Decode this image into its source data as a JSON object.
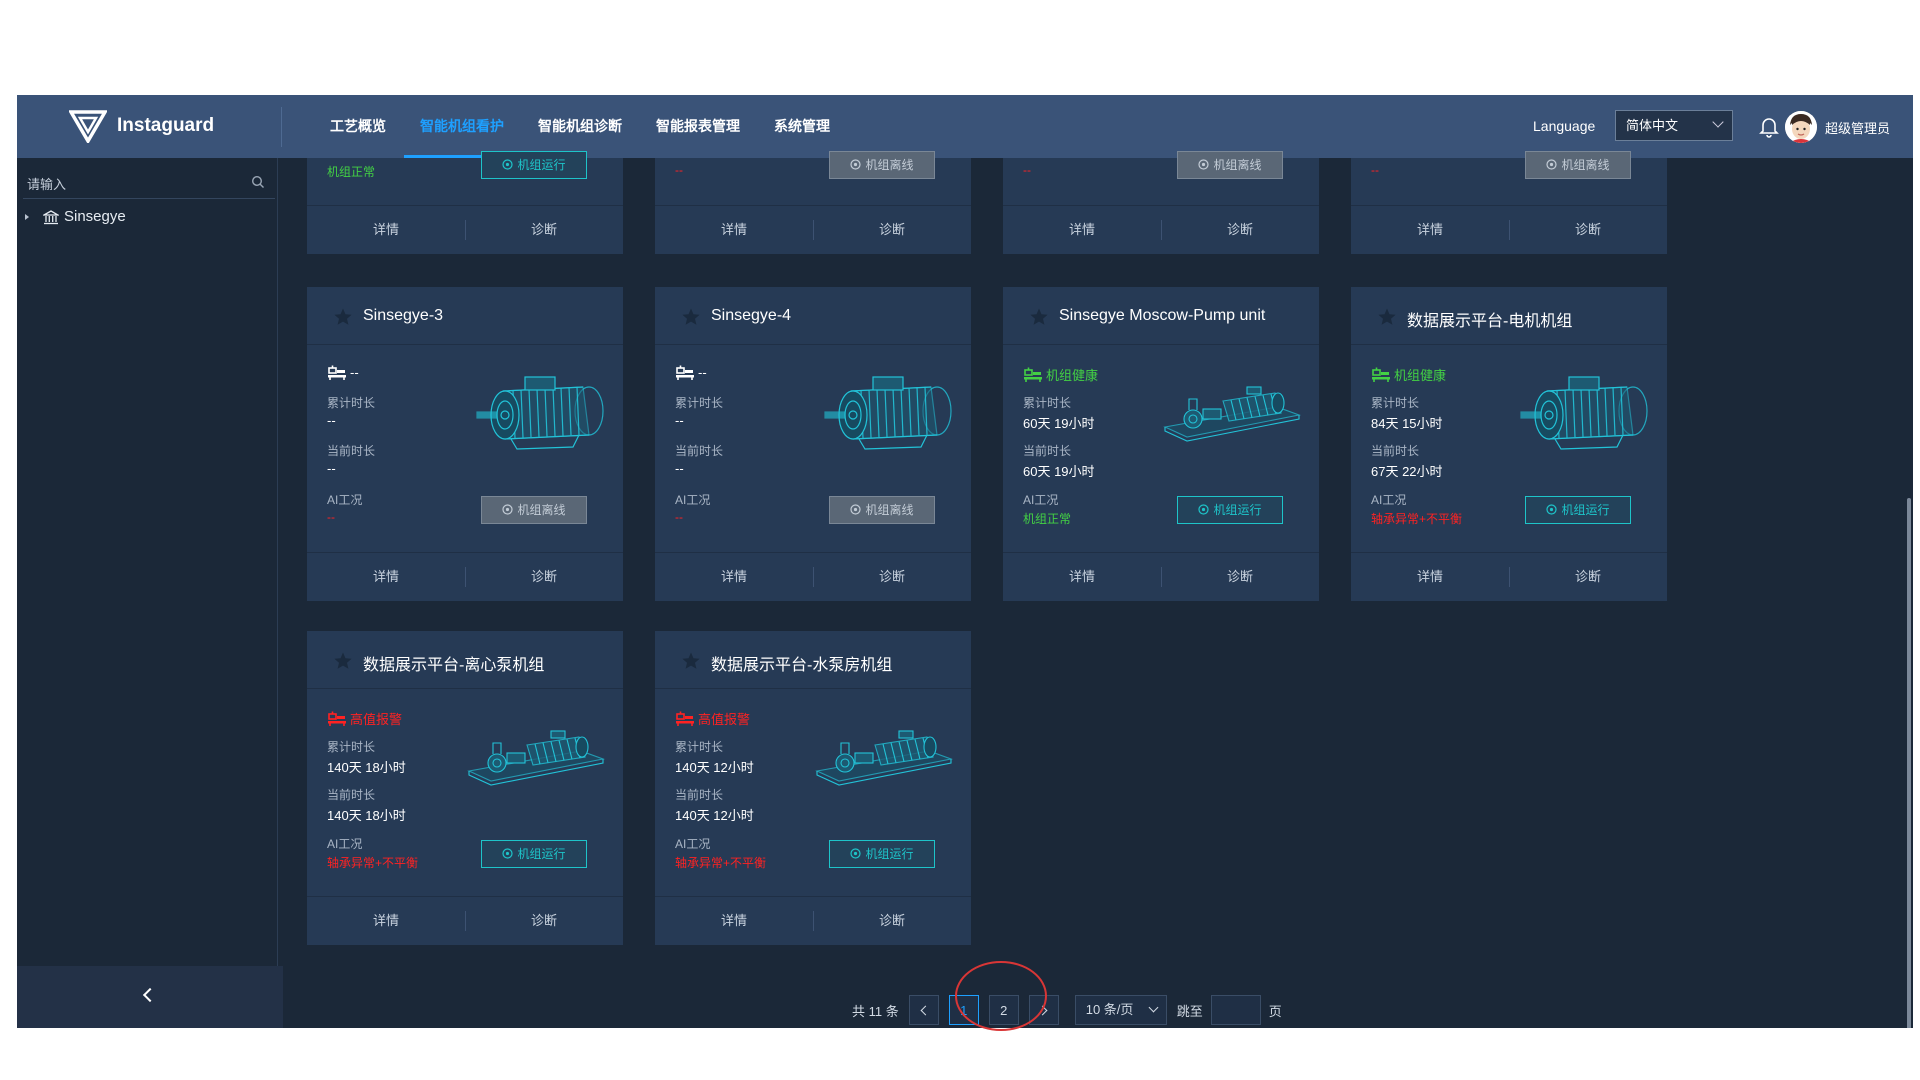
{
  "header": {
    "brand": "Instaguard",
    "nav": [
      "工艺概览",
      "智能机组看护",
      "智能机组诊断",
      "智能报表管理",
      "系统管理"
    ],
    "active_nav": 1,
    "language_label": "Language",
    "language_value": "简体中文",
    "user_name": "超级管理员"
  },
  "sidebar": {
    "search_placeholder": "请输入",
    "tree_root": "Sinsegye"
  },
  "card_labels": {
    "total_time": "累计时长",
    "current_time": "当前时长",
    "ai_status": "AI工况",
    "details": "详情",
    "diagnose": "诊断"
  },
  "top_row": [
    {
      "ai": "机组正常",
      "ai_color": "green",
      "button": "机组运行",
      "online": true
    },
    {
      "ai": "--",
      "ai_color": "red",
      "button": "机组离线",
      "online": false
    },
    {
      "ai": "--",
      "ai_color": "red",
      "button": "机组离线",
      "online": false
    },
    {
      "ai": "--",
      "ai_color": "red",
      "button": "机组离线",
      "online": false
    }
  ],
  "cards": [
    {
      "title": "Sinsegye-3",
      "status": "--",
      "status_color": "white",
      "total": "--",
      "current": "--",
      "ai": "--",
      "ai_color": "red",
      "button": "机组离线",
      "online": false,
      "machine": "motor"
    },
    {
      "title": "Sinsegye-4",
      "status": "--",
      "status_color": "white",
      "total": "--",
      "current": "--",
      "ai": "--",
      "ai_color": "red",
      "button": "机组离线",
      "online": false,
      "machine": "motor"
    },
    {
      "title": "Sinsegye Moscow-Pump unit",
      "status": "机组健康",
      "status_color": "green",
      "total": "60天 19小时",
      "current": "60天 19小时",
      "ai": "机组正常",
      "ai_color": "green",
      "button": "机组运行",
      "online": true,
      "machine": "pump"
    },
    {
      "title": "数据展示平台-电机机组",
      "status": "机组健康",
      "status_color": "green",
      "total": "84天 15小时",
      "current": "67天 22小时",
      "ai": "轴承异常+不平衡",
      "ai_color": "red",
      "button": "机组运行",
      "online": true,
      "machine": "motor"
    },
    {
      "title": "数据展示平台-离心泵机组",
      "status": "高值报警",
      "status_color": "red",
      "total": "140天 18小时",
      "current": "140天 18小时",
      "ai": "轴承异常+不平衡",
      "ai_color": "red",
      "button": "机组运行",
      "online": true,
      "machine": "pump"
    },
    {
      "title": "数据展示平台-水泵房机组",
      "status": "高值报警",
      "status_color": "red",
      "total": "140天 12小时",
      "current": "140天 12小时",
      "ai": "轴承异常+不平衡",
      "ai_color": "red",
      "button": "机组运行",
      "online": true,
      "machine": "pump"
    }
  ],
  "pagination": {
    "total": "共 11 条",
    "pages": [
      "1",
      "2"
    ],
    "active_page": "1",
    "page_size": "10 条/页",
    "jump_label": "跳至",
    "page_suffix": "页"
  },
  "colors": {
    "accent": "#1ea0ff",
    "header_bg": "#3a5378",
    "card_bg": "#263a55",
    "online": "#1ec4c9",
    "healthy": "#43d144",
    "alarm": "#ff2222"
  }
}
